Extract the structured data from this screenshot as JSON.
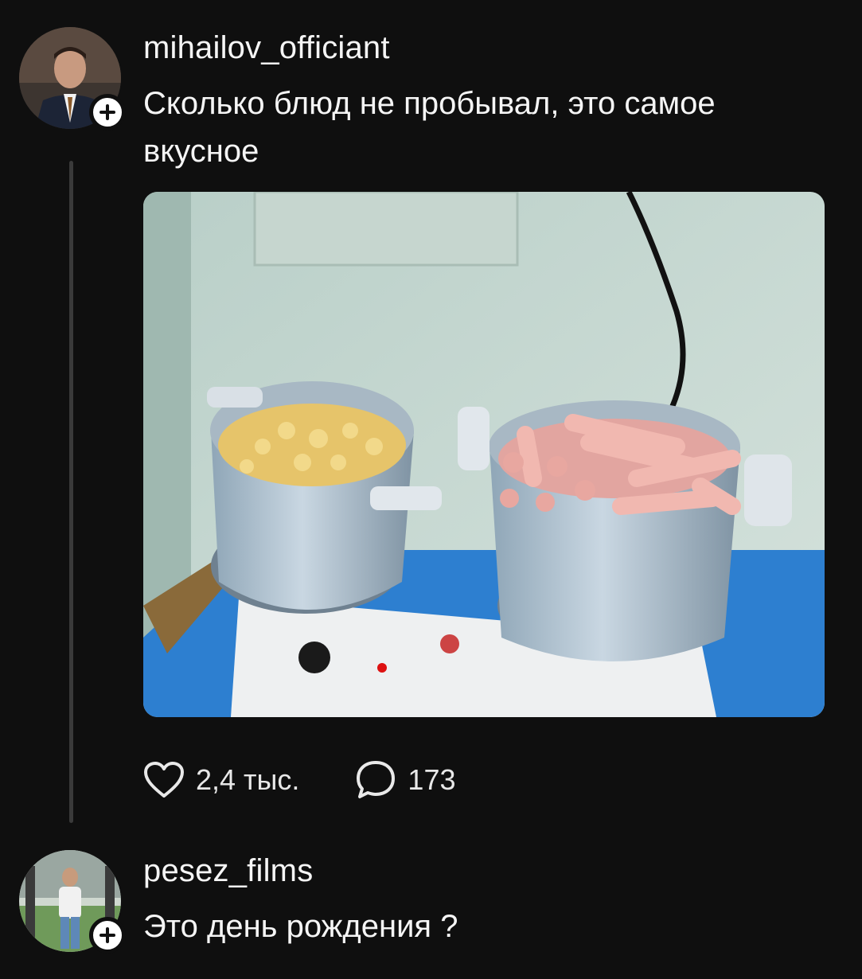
{
  "post": {
    "username": "mihailov_officiant",
    "text": "Сколько блюд не пробывал, это самое вкусное",
    "likes": "2,4 тыс.",
    "comments": "173"
  },
  "reply": {
    "username": "pesez_films",
    "text": "Это день рождения ?"
  },
  "colors": {
    "background": "#0f0f0f",
    "thread_line": "#3a3a3a",
    "text": "#f5f5f5"
  },
  "icons": {
    "like": "heart-icon",
    "comment": "speech-bubble-icon",
    "follow": "plus-icon"
  }
}
